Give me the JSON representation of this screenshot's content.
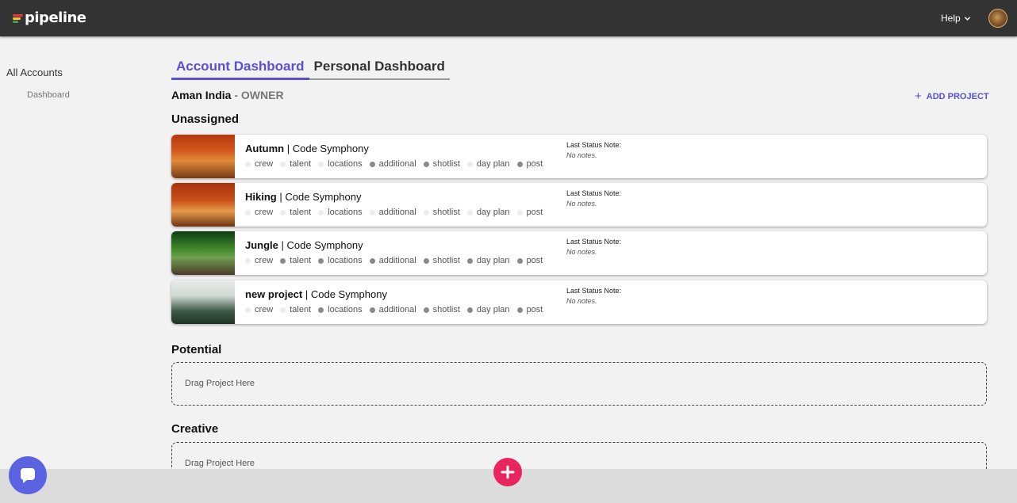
{
  "app": {
    "logo_text": "pipeline",
    "help_label": "Help"
  },
  "sidebar": {
    "all_accounts": "All Accounts",
    "dashboard": "Dashboard"
  },
  "tabs": [
    {
      "label": "Account Dashboard",
      "active": true
    },
    {
      "label": "Personal Dashboard",
      "active": false
    }
  ],
  "account": {
    "name": "Aman India",
    "separator": " - ",
    "role": "OWNER"
  },
  "add_project_label": "ADD PROJECT",
  "sections": {
    "unassigned": "Unassigned",
    "potential": "Potential",
    "creative": "Creative"
  },
  "dropzone_text": "Drag Project Here",
  "note_label": "Last Status Note:",
  "projects": [
    {
      "name": "Autumn",
      "separator": " | ",
      "client": "Code Symphony",
      "note": "No notes.",
      "stages": [
        {
          "label": "crew",
          "done": false
        },
        {
          "label": "talent",
          "done": false
        },
        {
          "label": "locations",
          "done": false
        },
        {
          "label": "additional",
          "done": true
        },
        {
          "label": "shotlist",
          "done": true
        },
        {
          "label": "day plan",
          "done": false
        },
        {
          "label": "post",
          "done": true
        }
      ]
    },
    {
      "name": "Hiking",
      "separator": " | ",
      "client": "Code Symphony",
      "note": "No notes.",
      "stages": [
        {
          "label": "crew",
          "done": false
        },
        {
          "label": "talent",
          "done": false
        },
        {
          "label": "locations",
          "done": false
        },
        {
          "label": "additional",
          "done": false
        },
        {
          "label": "shotlist",
          "done": false
        },
        {
          "label": "day plan",
          "done": false
        },
        {
          "label": "post",
          "done": false
        }
      ]
    },
    {
      "name": "Jungle",
      "separator": " | ",
      "client": "Code Symphony",
      "note": "No notes.",
      "stages": [
        {
          "label": "crew",
          "done": false
        },
        {
          "label": "talent",
          "done": true
        },
        {
          "label": "locations",
          "done": true
        },
        {
          "label": "additional",
          "done": true
        },
        {
          "label": "shotlist",
          "done": true
        },
        {
          "label": "day plan",
          "done": true
        },
        {
          "label": "post",
          "done": true
        }
      ]
    },
    {
      "name": "new project",
      "separator": " | ",
      "client": "Code Symphony",
      "note": "No notes.",
      "stages": [
        {
          "label": "crew",
          "done": false
        },
        {
          "label": "talent",
          "done": false
        },
        {
          "label": "locations",
          "done": true
        },
        {
          "label": "additional",
          "done": true
        },
        {
          "label": "shotlist",
          "done": true
        },
        {
          "label": "day plan",
          "done": true
        },
        {
          "label": "post",
          "done": true
        }
      ]
    }
  ],
  "colors": {
    "accent": "#5b4fd1",
    "topbar": "#333333",
    "fab": "#e8255f",
    "chat": "#5b63e0",
    "stage_done": "#8a8a8a",
    "stage_pending": "#ececec"
  }
}
